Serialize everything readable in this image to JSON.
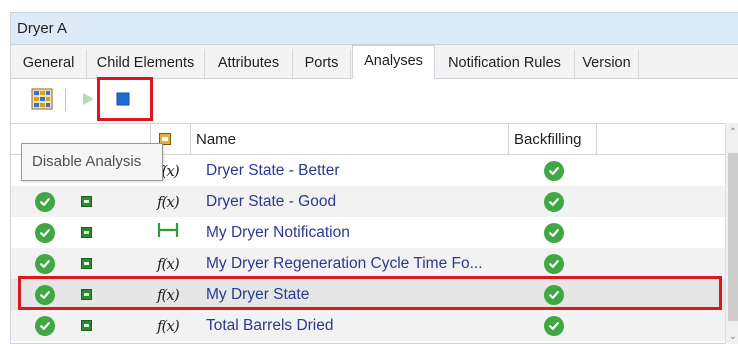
{
  "window": {
    "title": "Dryer A"
  },
  "tabs": [
    {
      "label": "General",
      "active": false
    },
    {
      "label": "Child Elements",
      "active": false
    },
    {
      "label": "Attributes",
      "active": false
    },
    {
      "label": "Ports",
      "active": false
    },
    {
      "label": "Analyses",
      "active": true
    },
    {
      "label": "Notification Rules",
      "active": false
    },
    {
      "label": "Version",
      "active": false
    }
  ],
  "toolbar": {
    "buttons": [
      {
        "icon": "analysis-grid-icon",
        "enabled": true
      },
      {
        "icon": "play-icon",
        "enabled": false
      },
      {
        "icon": "stop-icon",
        "enabled": true,
        "highlighted": true
      }
    ]
  },
  "tooltip": {
    "text": "Disable Analysis"
  },
  "grid": {
    "columns": {
      "name": "Name",
      "backfilling": "Backfilling"
    },
    "rows": [
      {
        "name": "Dryer State - Better",
        "type_icon": "fx-icon",
        "status": "ok",
        "backfilling": "ok",
        "selected": false
      },
      {
        "name": "Dryer State - Good",
        "type_icon": "fx-icon",
        "status": "ok",
        "backfilling": "ok",
        "selected": false
      },
      {
        "name": "My Dryer Notification",
        "type_icon": "notification-bracket-icon",
        "status": "ok",
        "backfilling": "ok",
        "selected": false
      },
      {
        "name": "My Dryer Regeneration Cycle Time Fo...",
        "type_icon": "fx-icon",
        "status": "ok",
        "backfilling": "ok",
        "selected": false
      },
      {
        "name": "My Dryer State",
        "type_icon": "fx-icon",
        "status": "ok",
        "backfilling": "ok",
        "selected": true
      },
      {
        "name": "Total Barrels Dried",
        "type_icon": "fx-icon",
        "status": "ok",
        "backfilling": "ok",
        "selected": false
      }
    ]
  },
  "colors": {
    "highlight": "#d9191c",
    "ok_green": "#3fa743",
    "link_blue": "#2a3a8f",
    "stop_blue": "#1f6ad6"
  }
}
